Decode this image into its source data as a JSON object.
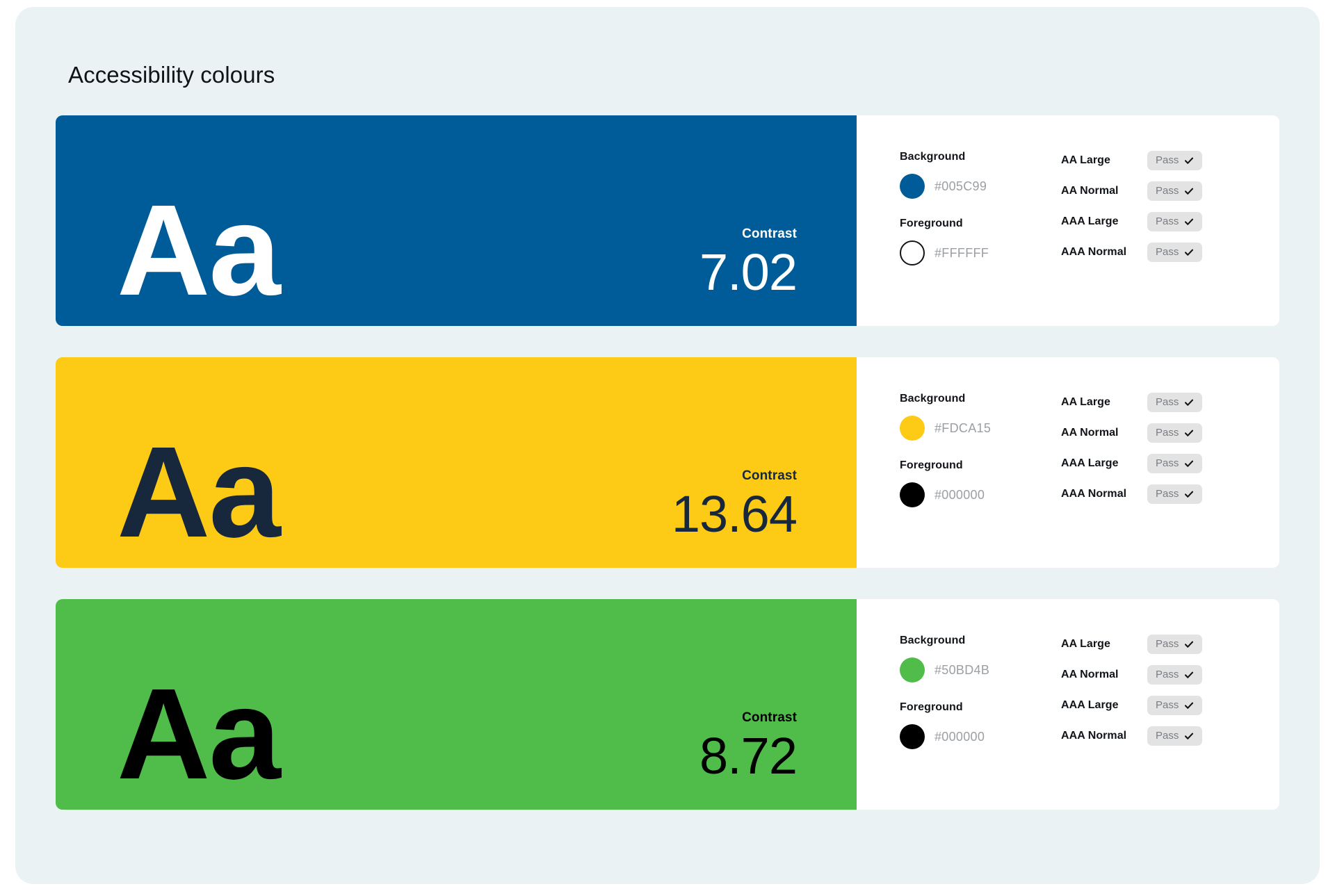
{
  "page": {
    "title": "Accessibility colours",
    "background_color": "#eaf2f4",
    "panel_color": "#ffffff"
  },
  "labels": {
    "contrast": "Contrast",
    "sample_text": "Aa",
    "background": "Background",
    "foreground": "Foreground",
    "check_icon": "check-icon"
  },
  "cards": [
    {
      "name": "blue",
      "sample_text": "Aa",
      "contrast_label": "Contrast",
      "contrast_value": "7.02",
      "background_label": "Background",
      "background_hex": "#005C99",
      "foreground_label": "Foreground",
      "foreground_hex": "#FFFFFF",
      "levels": [
        {
          "label": "AA Large",
          "status": "Pass"
        },
        {
          "label": "AA Normal",
          "status": "Pass"
        },
        {
          "label": "AAA Large",
          "status": "Pass"
        },
        {
          "label": "AAA Normal",
          "status": "Pass"
        }
      ]
    },
    {
      "name": "yellow",
      "sample_text": "Aa",
      "contrast_label": "Contrast",
      "contrast_value": "13.64",
      "background_label": "Background",
      "background_hex": "#FDCA15",
      "foreground_label": "Foreground",
      "foreground_hex": "#000000",
      "levels": [
        {
          "label": "AA Large",
          "status": "Pass"
        },
        {
          "label": "AA Normal",
          "status": "Pass"
        },
        {
          "label": "AAA Large",
          "status": "Pass"
        },
        {
          "label": "AAA Normal",
          "status": "Pass"
        }
      ]
    },
    {
      "name": "green",
      "sample_text": "Aa",
      "contrast_label": "Contrast",
      "contrast_value": "8.72",
      "background_label": "Background",
      "background_hex": "#50BD4B",
      "foreground_label": "Foreground",
      "foreground_hex": "#000000",
      "levels": [
        {
          "label": "AA Large",
          "status": "Pass"
        },
        {
          "label": "AA Normal",
          "status": "Pass"
        },
        {
          "label": "AAA Large",
          "status": "Pass"
        },
        {
          "label": "AAA Normal",
          "status": "Pass"
        }
      ]
    }
  ],
  "render": {
    "swatch_text_colors": [
      "#ffffff",
      "#18283c",
      "#000000"
    ],
    "swatch_label_colors": [
      "#ffffff",
      "#18283c",
      "#000000"
    ],
    "foreground_dot_outlined": [
      true,
      false,
      false
    ]
  }
}
